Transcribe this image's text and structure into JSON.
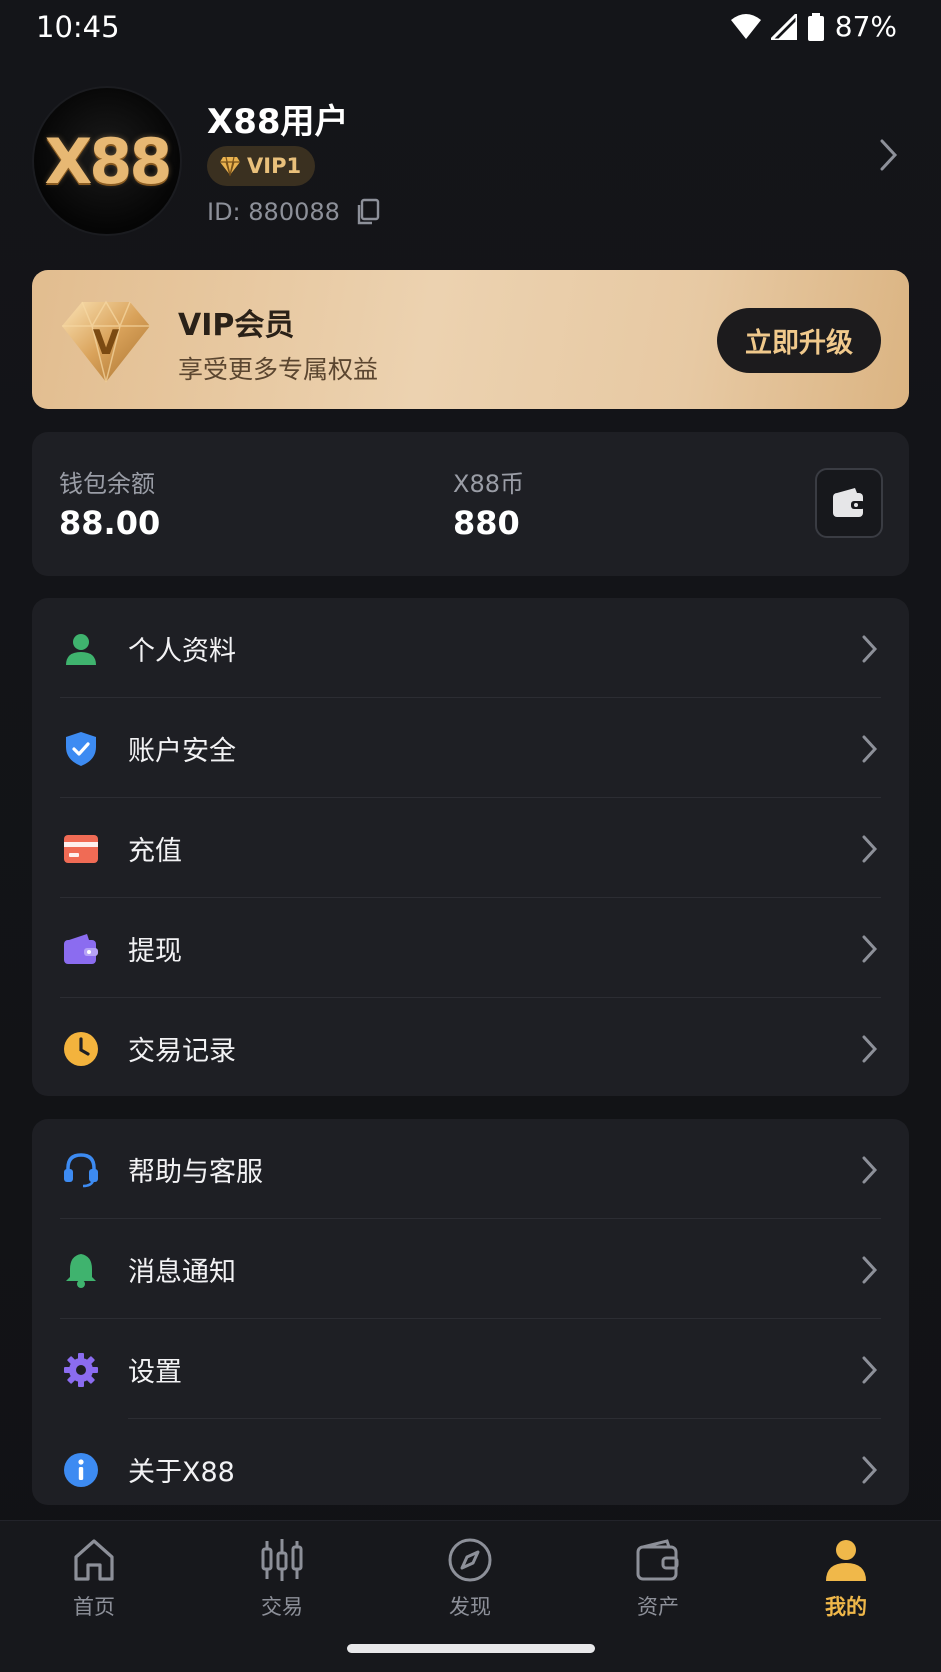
{
  "status_bar": {
    "time": "10:45",
    "battery": "87%"
  },
  "profile": {
    "avatar_text": "X88",
    "username": "X88用户",
    "vip_level": "VIP1",
    "user_id": "ID: 880088"
  },
  "vip_banner": {
    "gem_letter": "V",
    "title": "VIP会员",
    "subtitle": "享受更多专属权益",
    "button": "立即升级"
  },
  "wallet": {
    "balance_label": "钱包余额",
    "balance_value": "88.00",
    "coin_label": "X88币",
    "coin_value": "880"
  },
  "menu_group_1": [
    {
      "label": "个人资料",
      "icon": "person-icon",
      "color": "#3fb36e"
    },
    {
      "label": "账户安全",
      "icon": "shield-icon",
      "color": "#3d8bf2"
    },
    {
      "label": "充值",
      "icon": "card-icon",
      "color": "#f06b55"
    },
    {
      "label": "提现",
      "icon": "wallet-icon",
      "color": "#8b6cf0"
    },
    {
      "label": "交易记录",
      "icon": "clock-icon",
      "color": "#f3b33d"
    }
  ],
  "menu_group_2": [
    {
      "label": "帮助与客服",
      "icon": "headset-icon",
      "color": "#3d8bf2"
    },
    {
      "label": "消息通知",
      "icon": "bell-icon",
      "color": "#3fb36e"
    },
    {
      "label": "设置",
      "icon": "gear-icon",
      "color": "#8b6cf0"
    },
    {
      "label": "关于X88",
      "icon": "info-icon",
      "color": "#3d8bf2"
    }
  ],
  "bottom_nav": [
    {
      "label": "首页",
      "icon": "home-icon"
    },
    {
      "label": "交易",
      "icon": "candlestick-icon"
    },
    {
      "label": "发现",
      "icon": "compass-icon"
    },
    {
      "label": "资产",
      "icon": "wallet-icon"
    },
    {
      "label": "我的",
      "icon": "user-icon",
      "active": true
    }
  ],
  "colors": {
    "accent_gold": "#f0b84a",
    "background": "#121317",
    "card": "#1e1f24"
  }
}
